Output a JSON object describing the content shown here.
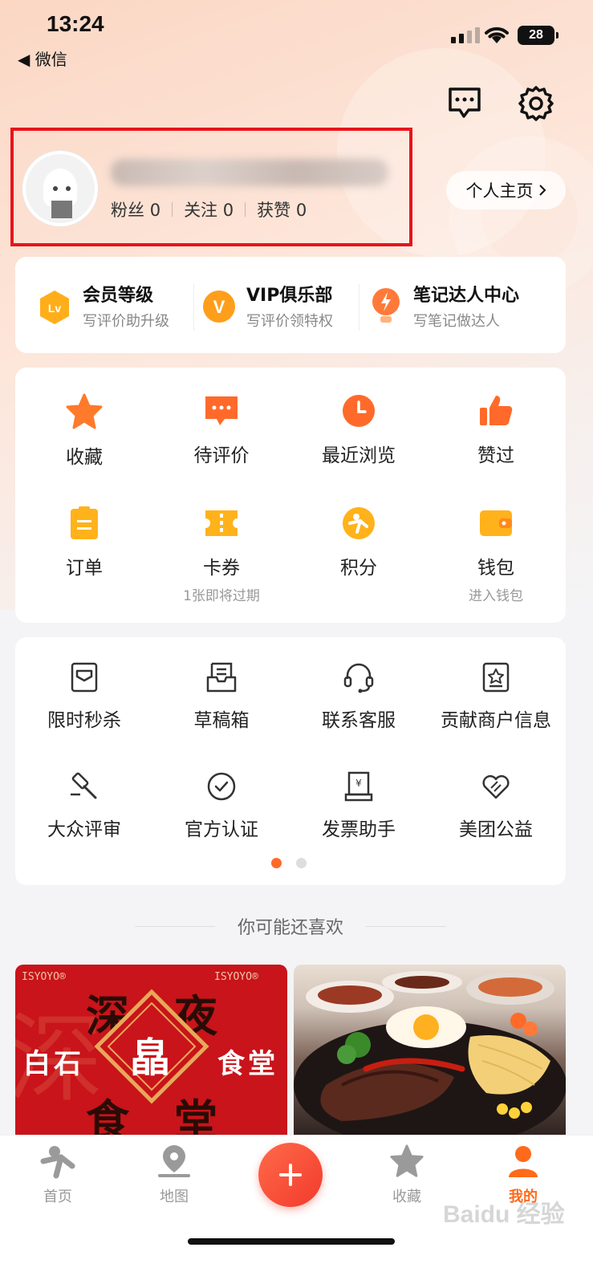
{
  "status_bar": {
    "time": "13:24",
    "back_label": "◀ 微信",
    "battery": "28"
  },
  "profile": {
    "stats": [
      {
        "label": "粉丝",
        "value": "0"
      },
      {
        "label": "关注",
        "value": "0"
      },
      {
        "label": "获赞",
        "value": "0"
      }
    ],
    "homepage_label": "个人主页"
  },
  "vip_row": [
    {
      "title": "会员等级",
      "subtitle": "写评价助升级",
      "icon": "lv-badge-icon"
    },
    {
      "title": "VIP俱乐部",
      "subtitle": "写评价领特权",
      "icon": "vip-badge-icon"
    },
    {
      "title": "笔记达人中心",
      "subtitle": "写笔记做达人",
      "icon": "lightbulb-badge-icon"
    }
  ],
  "grid1": [
    {
      "label": "收藏",
      "sub": "",
      "icon": "star-icon"
    },
    {
      "label": "待评价",
      "sub": "",
      "icon": "comment-icon"
    },
    {
      "label": "最近浏览",
      "sub": "",
      "icon": "clock-icon"
    },
    {
      "label": "赞过",
      "sub": "",
      "icon": "thumbs-up-icon"
    },
    {
      "label": "订单",
      "sub": "",
      "icon": "order-icon"
    },
    {
      "label": "卡券",
      "sub": "1张即将过期",
      "icon": "coupon-icon"
    },
    {
      "label": "积分",
      "sub": "",
      "icon": "points-icon"
    },
    {
      "label": "钱包",
      "sub": "进入钱包",
      "icon": "wallet-icon"
    }
  ],
  "grid2": [
    {
      "label": "限时秒杀",
      "icon": "flash-sale-icon"
    },
    {
      "label": "草稿箱",
      "icon": "drafts-icon"
    },
    {
      "label": "联系客服",
      "icon": "headset-icon"
    },
    {
      "label": "贡献商户信息",
      "icon": "merchant-info-icon"
    },
    {
      "label": "大众评审",
      "icon": "gavel-icon"
    },
    {
      "label": "官方认证",
      "icon": "verified-icon"
    },
    {
      "label": "发票助手",
      "icon": "invoice-icon"
    },
    {
      "label": "美团公益",
      "icon": "charity-icon"
    }
  ],
  "recommend_title": "你可能还喜欢",
  "poster1": {
    "brand": "ISYOYO®",
    "chars_big": [
      "深",
      "夜",
      "食",
      "堂"
    ],
    "chars_side": [
      "白",
      "石",
      "食",
      "堂"
    ],
    "center_char": "皛"
  },
  "tabbar": [
    {
      "label": "首页",
      "icon": "home-mascot-icon"
    },
    {
      "label": "地图",
      "icon": "map-pin-icon"
    },
    {
      "label": "收藏",
      "icon": "star-tab-icon"
    },
    {
      "label": "我的",
      "icon": "profile-icon"
    }
  ],
  "watermark": "Baidu 经验",
  "colors": {
    "accent": "#ff6a1a",
    "highlight_box": "#e8141b"
  }
}
